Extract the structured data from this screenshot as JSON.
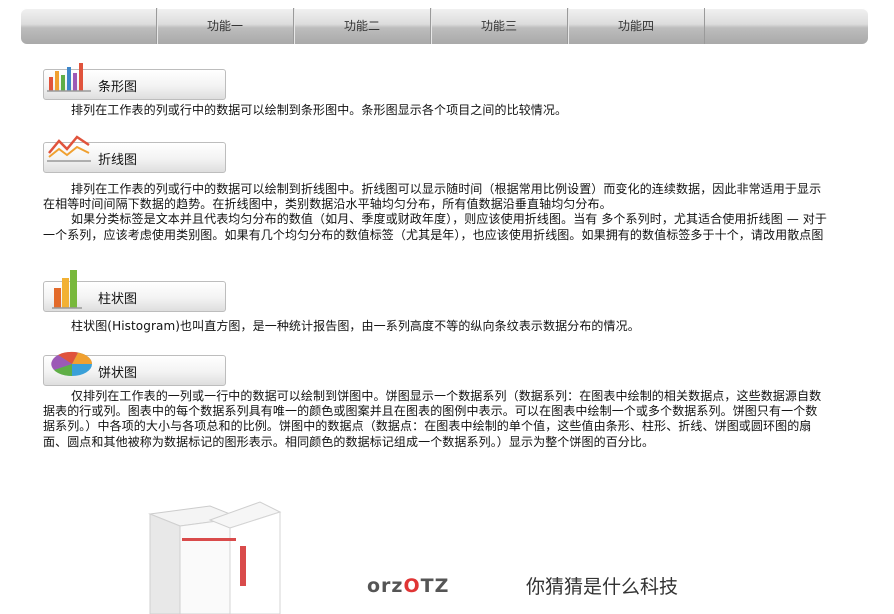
{
  "nav": {
    "items": [
      {
        "label": "功能一"
      },
      {
        "label": "功能二"
      },
      {
        "label": "功能三"
      },
      {
        "label": "功能四"
      }
    ]
  },
  "sections": [
    {
      "title": "条形图",
      "icon": "bar-chart-icon",
      "paragraphs": [
        "排列在工作表的列或行中的数据可以绘制到条形图中。条形图显示各个项目之间的比较情况。"
      ]
    },
    {
      "title": "折线图",
      "icon": "line-chart-icon",
      "paragraphs": [
        "排列在工作表的列或行中的数据可以绘制到折线图中。折线图可以显示随时间（根据常用比例设置）而变化的连续数据，因此非常适用于显示在相等时间间隔下数据的趋势。在折线图中，类别数据沿水平轴均匀分布，所有值数据沿垂直轴均匀分布。",
        "如果分类标签是文本并且代表均匀分布的数值（如月、季度或财政年度），则应该使用折线图。当有 多个系列时，尤其适合使用折线图 — 对于一个系列，应该考虑使用类别图。如果有几个均匀分布的数值标签（尤其是年），也应该使用折线图。如果拥有的数值标签多于十个，请改用散点图"
      ]
    },
    {
      "title": "柱状图",
      "icon": "column-chart-icon",
      "paragraphs": [
        "柱状图(Histogram)也叫直方图，是一种统计报告图，由一系列高度不等的纵向条纹表示数据分布的情况。"
      ]
    },
    {
      "title": "饼状图",
      "icon": "pie-chart-icon",
      "paragraphs": [
        "仅排列在工作表的一列或一行中的数据可以绘制到饼图中。饼图显示一个数据系列（数据系列：在图表中绘制的相关数据点，这些数据源自数据表的行或列。图表中的每个数据系列具有唯一的颜色或图案并且在图表的图例中表示。可以在图表中绘制一个或多个数据系列。饼图只有一个数据系列。）中各项的大小与各项总和的比例。饼图中的数据点（数据点：在图表中绘制的单个值，这些值由条形、柱形、折线、饼图或圆环图的扇面、圆点和其他被称为数据标记的图形表示。相同颜色的数据标记组成一个数据系列。）显示为整个饼图的百分比。"
      ]
    }
  ],
  "footer": {
    "brand_prefix": "orz",
    "brand_o": "O",
    "brand_suffix": "TZ",
    "slogan": "你猜猜是什么科技"
  },
  "colors": {
    "brand_accent": "#e03535",
    "nav_gradient_top": "#f2f2f2",
    "nav_gradient_bottom": "#a9a9a9"
  }
}
